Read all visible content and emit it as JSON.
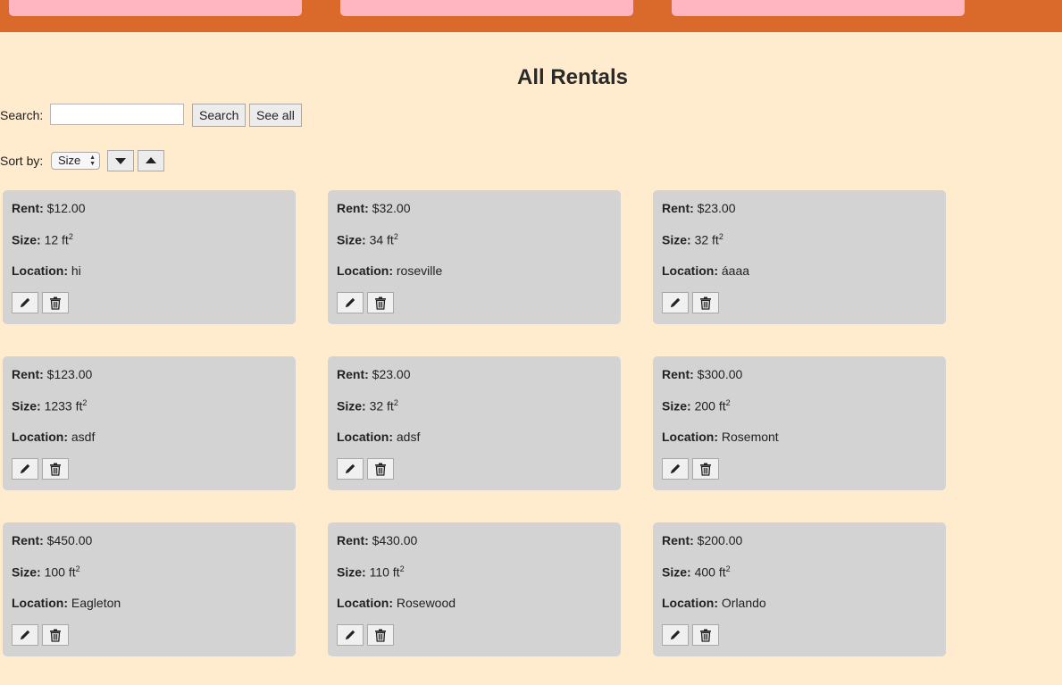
{
  "page": {
    "title": "All Rentals"
  },
  "search": {
    "label": "Search:",
    "value": "",
    "button_label": "Search",
    "see_all_label": "See all"
  },
  "sort": {
    "label": "Sort by:",
    "selected": "Size",
    "desc_icon": "triangle-down-icon",
    "asc_icon": "triangle-up-icon"
  },
  "colors": {
    "topbar": "#da6a2c",
    "tab": "#ffb6c1",
    "background": "#ffebcd",
    "card": "#d3d3d3"
  },
  "field_labels": {
    "rent": "Rent:",
    "size": "Size:",
    "location": "Location:"
  },
  "units": {
    "size": "ft",
    "exp": "2"
  },
  "rentals": [
    {
      "rent": "$12.00",
      "size": "12",
      "location": "hi"
    },
    {
      "rent": "$32.00",
      "size": "34",
      "location": "roseville"
    },
    {
      "rent": "$23.00",
      "size": "32",
      "location": "áaaa"
    },
    {
      "rent": "$123.00",
      "size": "1233",
      "location": "asdf"
    },
    {
      "rent": "$23.00",
      "size": "32",
      "location": "adsf"
    },
    {
      "rent": "$300.00",
      "size": "200",
      "location": "Rosemont"
    },
    {
      "rent": "$450.00",
      "size": "100",
      "location": "Eagleton"
    },
    {
      "rent": "$430.00",
      "size": "110",
      "location": "Rosewood"
    },
    {
      "rent": "$200.00",
      "size": "400",
      "location": "Orlando"
    }
  ]
}
